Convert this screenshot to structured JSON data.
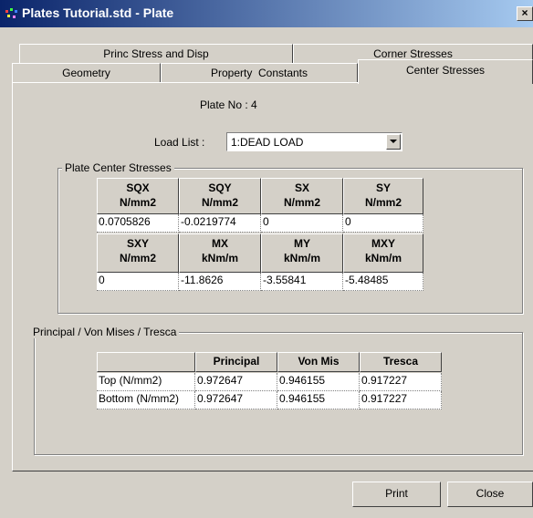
{
  "window": {
    "title": "Plates Tutorial.std - Plate",
    "close_glyph": "×"
  },
  "tabs": {
    "row1": [
      "Princ Stress and Disp",
      "Corner Stresses"
    ],
    "row2": [
      "Geometry",
      "Property  Constants",
      "Center Stresses"
    ],
    "active": "Center Stresses"
  },
  "plate_no": "Plate No : 4",
  "load_list": {
    "label": "Load List :",
    "value": "1:DEAD LOAD"
  },
  "center_stresses": {
    "title": "Plate Center Stresses",
    "headers1": [
      [
        "SQX",
        "N/mm2"
      ],
      [
        "SQY",
        "N/mm2"
      ],
      [
        "SX",
        "N/mm2"
      ],
      [
        "SY",
        "N/mm2"
      ]
    ],
    "values1": [
      "0.0705826",
      "-0.0219774",
      "0",
      "0"
    ],
    "headers2": [
      [
        "SXY",
        "N/mm2"
      ],
      [
        "MX",
        "kNm/m"
      ],
      [
        "MY",
        "kNm/m"
      ],
      [
        "MXY",
        "kNm/m"
      ]
    ],
    "values2": [
      "0",
      "-11.8626",
      "-3.55841",
      "-5.48485"
    ]
  },
  "principal": {
    "title": "Principal / Von Mises / Tresca",
    "headers": [
      "",
      "Principal",
      "Von Mis",
      "Tresca"
    ],
    "rows": [
      [
        "Top (N/mm2)",
        "0.972647",
        "0.946155",
        "0.917227"
      ],
      [
        "Bottom (N/mm2)",
        "0.972647",
        "0.946155",
        "0.917227"
      ]
    ]
  },
  "buttons": {
    "print": "Print",
    "close": "Close"
  }
}
